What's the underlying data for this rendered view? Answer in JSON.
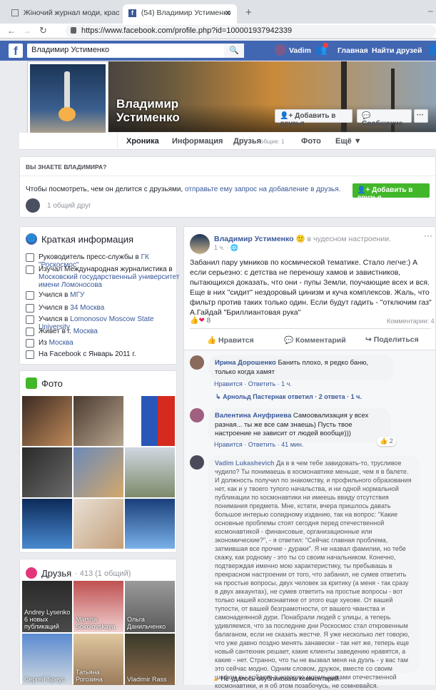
{
  "browser": {
    "tab1": "Жіночий журнал моди, краси і",
    "tab2": "(54) Владимир Устименко",
    "url": "https://www.facebook.com/profile.php?id=100001937942339"
  },
  "fbbar": {
    "search": "Владимир Устименко",
    "user": "Vadim",
    "home": "Главная",
    "find_friends": "Найти друзей"
  },
  "profile": {
    "name_line1": "Владимир",
    "name_line2": "Устименко",
    "add_friend": "Добавить в друзья",
    "message": "Сообщение",
    "more": "···"
  },
  "tabs": {
    "chronicle": "Хроника",
    "info": "Информация",
    "friends": "Друзья",
    "friends_common": "общие: 1",
    "photo": "Фото",
    "more": "Ещё ▼"
  },
  "know": {
    "heading": "ВЫ ЗНАЕТЕ ВЛАДИМИРА?",
    "text": "Чтобы посмотреть, чем он делится с друзьями,",
    "link": "отправьте ему запрос на добавление в друзья.",
    "button": "Добавить в друзья",
    "mutual": "1 общий друг"
  },
  "intro": {
    "title": "Краткая информация",
    "rows": [
      {
        "pre": "Руководитель пресс-службы в",
        "link": "ГК \"Роскосмос\"",
        "post": ""
      },
      {
        "pre": "Изучал Международная журналистика в",
        "link": "Московский государственный университет имени Ломоносова",
        "post": ""
      },
      {
        "pre": "Учился в",
        "link": "МГУ",
        "post": ""
      },
      {
        "pre": "Учился в",
        "link": "34 Москва",
        "post": ""
      },
      {
        "pre": "Учился в",
        "link": "Lomonosov Moscow State University",
        "post": ""
      },
      {
        "pre": "Живет в г.",
        "link": "Москва",
        "post": ""
      },
      {
        "pre": "Из",
        "link": "Москва",
        "post": ""
      },
      {
        "pre": "На Facebook с Январь 2011 г.",
        "link": "",
        "post": ""
      }
    ]
  },
  "photos": {
    "title": "Фото"
  },
  "friends": {
    "title": "Друзья",
    "count": "· 413 (1 общий)",
    "list": [
      "Andrey Lysenko",
      "6 новых публикаций",
      "Marsha Sokolovskaya",
      "Ольга Данильченко",
      "Сергей Бреус",
      "Татьяна Рогозина",
      "Vladimir Rass"
    ]
  },
  "post": {
    "author": "Владимир Устименко",
    "mood": "в чудесном настроении.",
    "time": "1 ч.",
    "text": "Забанил пару умников по космической тематике. Стало легче:) А если серьезно: с детства не переношу хамов и завистников, пытающихся доказать, что они - пупы Земли, поучающие всех и вся. Еще в них \"сидит\" нездоровый цинизм и куча комплексов. Жаль, что фильтр против таких только один. Если будут гадить - \"отключим газ\" А.Гайдай \"Бриллиантовая рука\"",
    "reactions": "8",
    "comments_count": "Комментарии: 4",
    "like": "Нравится",
    "comment": "Комментарий",
    "share": "Поделиться"
  },
  "comments": [
    {
      "author": "Ирина Дорошенко",
      "text": "Банить плохо, я редко баню, только когда хамят",
      "meta": "Нравится · Ответить · 1 ч."
    },
    {
      "reply": "Арнольд Пастернак ответил · 2 ответа · 1 ч."
    },
    {
      "author": "Валентина Ануфриева",
      "text": "Самоовализация у всех разная... ты же все сам знаешь) Пусть твое настроение не зависит от людей вообще)))",
      "meta": "Нравится · Ответить · 41 мин.",
      "likes": "2"
    },
    {
      "author": "Vadim Lukashevich",
      "text": "Да в в чем тебе завидовать-то, трусливое чудило? Ты понимаешь в космонавтике меньше, чем я в балете. И должность получил по знакомству, и профильного образования нет, как и у твоего тупого начальства, и ни одной нормальной публикации по космонавтики ни имеешь ввиду отсутствия понимания предмета. Мне, кстати, вчера пришлось давать большое интерью солидному изданию, так на вопрос: \"Какие основные проблемы стоят сегодня перед отечественной космонавтикой - финансовые, организационные или экономические?\", - я ответил: \"Сейчас главная проблема, затмившая все прочие - дураки\". Я не назвал фамилии, но тебе скажу, как родному - это ты со своим начальником. Конечно, подтверждая именно мою характеристику, ты пребывашь в прекрасном настроении от того, что забанил, не сумев ответить на простые вопросы, двух человек за критику (а меня - так сразу в двух аккаунтах), не сумев ответить на простые вопросы - вот только нашей космонавтике от этого еще хуеове. От вашей тупости, от вашей безграмотности, от вашего чванства и самонадеянной дури. Понабрали людей с улицы, а теперь удивляемся, что за последние дни Роскосмос стал откровенным балаганом, если не сказать жестче. Я уже несколько лет говорю, что уже давно поздно менять занавески - так нет же, теперь еще новый сантехник решает, какие клиенты заведению нравятся, а какие - нет. Странно, что ты не вызвал меня на дуэль - у вас там это сейчас модно. Одним словом, дружок, вместе со своим шефом вы войдете в историю могильщиками отечественной космонавтики, и я об этом позабочусь, не сомневайся.",
      "error": "Не удалось опубликовать комментарий."
    }
  ],
  "colors": {
    "fb_blue": "#4267b2",
    "link": "#385898",
    "green": "#42b72a"
  }
}
